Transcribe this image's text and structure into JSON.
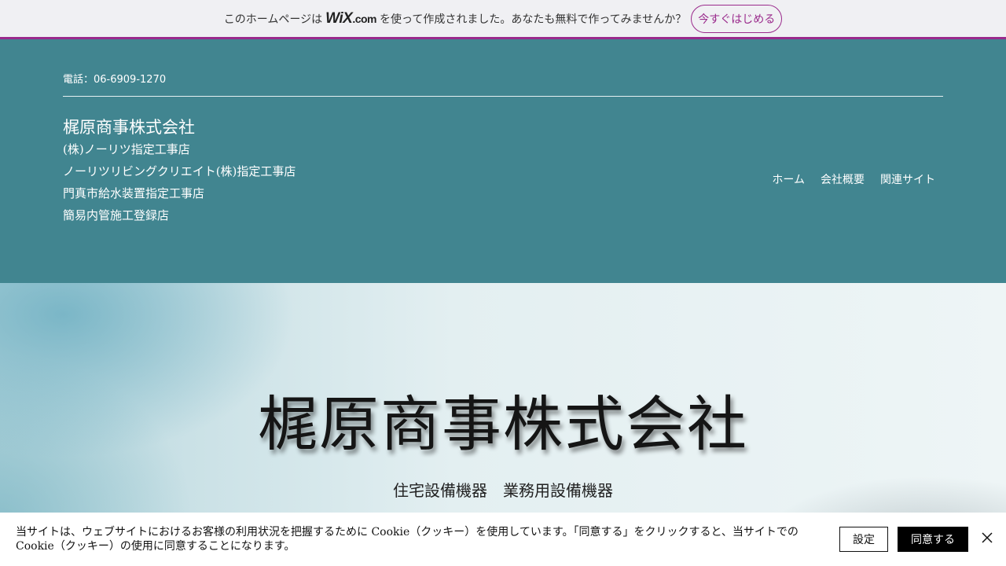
{
  "wix_banner": {
    "text_before": "このホームページは",
    "logo_main": "WiX",
    "logo_suffix": ".com",
    "text_after": "を使って作成されました。あなたも無料で作ってみませんか？",
    "cta_label": "今すぐはじめる",
    "accent_color": "#9a2a8c"
  },
  "header": {
    "phone": "電話：06-6909-1270",
    "company_name": "梶原商事株式会社",
    "lines": [
      "(株)ノーリツ指定工事店",
      "ノーリツリビングクリエイト(株)指定工事店",
      "門真市給水装置指定工事店",
      "簡易内管施工登録店"
    ],
    "nav": [
      "ホーム",
      "会社概要",
      "関連サイト"
    ],
    "background_color": "#418590"
  },
  "hero": {
    "title": "梶原商事株式会社",
    "subtitle": "住宅設備機器　業務用設備機器"
  },
  "cookie_bar": {
    "text": "当サイトは、ウェブサイトにおけるお客様の利用状況を把握するために Cookie（クッキー）を使用しています。「同意する」をクリックすると、当サイトでの Cookie（クッキー）の使用に同意することになります。",
    "settings_label": "設定",
    "agree_label": "同意する",
    "close_icon": "close-icon"
  }
}
